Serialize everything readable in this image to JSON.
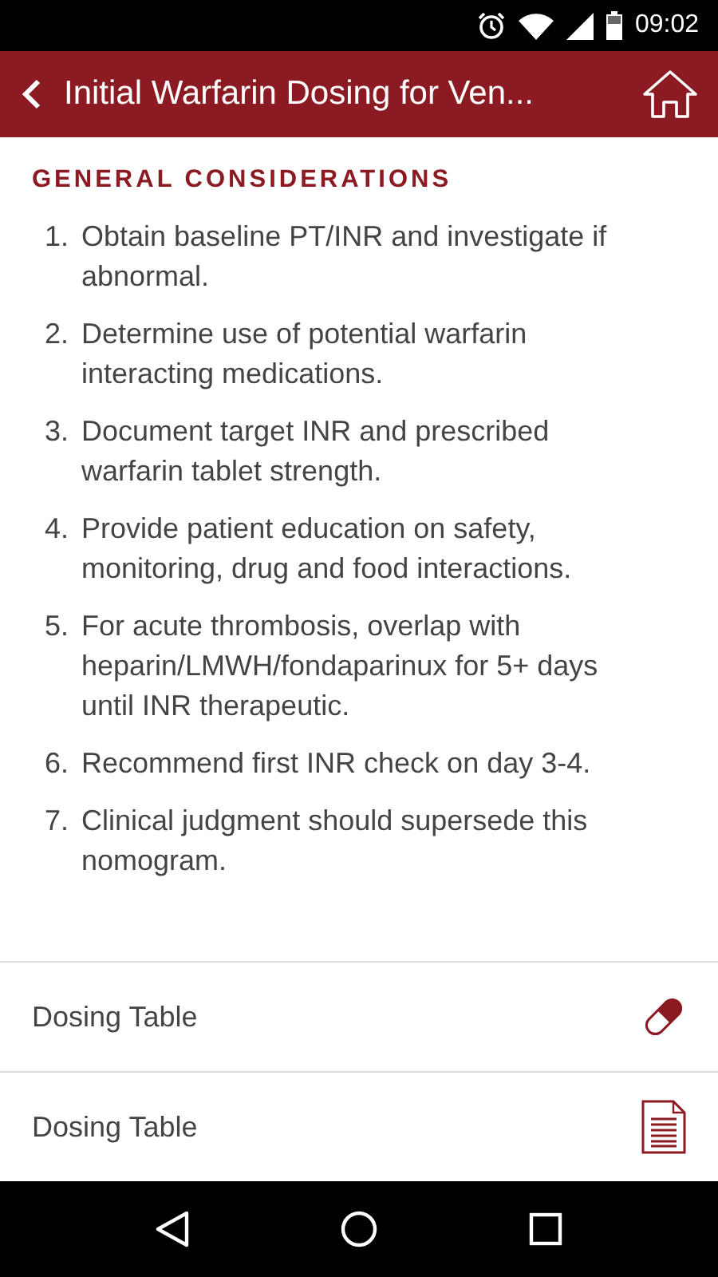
{
  "status_bar": {
    "time": "09:02"
  },
  "header": {
    "title": "Initial Warfarin Dosing for Ven..."
  },
  "section": {
    "heading": "GENERAL CONSIDERATIONS",
    "items": [
      {
        "number": "1.",
        "text": "Obtain baseline PT/INR and investigate if abnormal."
      },
      {
        "number": "2.",
        "text": "Determine use of potential warfarin interacting medications."
      },
      {
        "number": "3.",
        "text": "Document target INR and prescribed warfarin tablet strength."
      },
      {
        "number": "4.",
        "text": "Provide patient education on safety, monitoring, drug and food interactions."
      },
      {
        "number": "5.",
        "text": "For acute thrombosis, overlap with heparin/LMWH/fondaparinux for 5+ days until INR therapeutic."
      },
      {
        "number": "6.",
        "text": "Recommend first INR check on day 3-4."
      },
      {
        "number": "7.",
        "text": "Clinical judgment should supersede this nomogram."
      }
    ]
  },
  "links": [
    {
      "label": "Dosing Table",
      "kind": "pill"
    },
    {
      "label": "Dosing Table",
      "kind": "document"
    }
  ]
}
